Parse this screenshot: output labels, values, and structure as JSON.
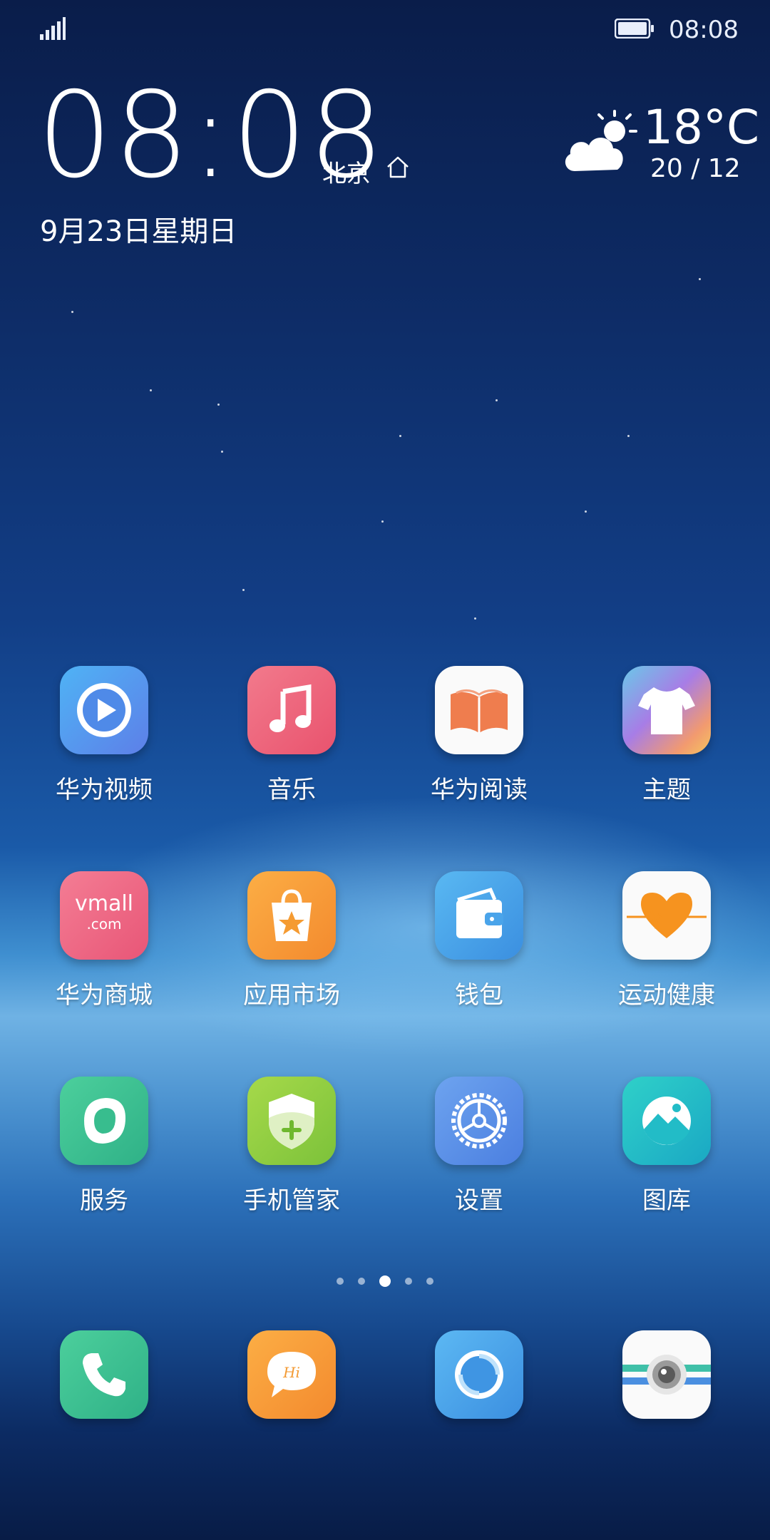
{
  "status_bar": {
    "time": "08:08",
    "signal_icon": "signal-icon",
    "battery_icon": "battery-icon"
  },
  "clock_widget": {
    "time": "08:08",
    "city": "北京",
    "date": "9月23日星期日"
  },
  "weather_widget": {
    "icon": "partly-cloudy-icon",
    "temperature": "18°C",
    "range": "20 / 12"
  },
  "apps": [
    {
      "label": "华为视频",
      "icon": "video-icon"
    },
    {
      "label": "音乐",
      "icon": "music-icon"
    },
    {
      "label": "华为阅读",
      "icon": "book-icon"
    },
    {
      "label": "主题",
      "icon": "tshirt-icon"
    },
    {
      "label": "华为商城",
      "icon": "vmall-icon",
      "tile_text": "vmall",
      "tile_subtext": ".com"
    },
    {
      "label": "应用市场",
      "icon": "shopping-bag-icon"
    },
    {
      "label": "钱包",
      "icon": "wallet-icon"
    },
    {
      "label": "运动健康",
      "icon": "heart-pulse-icon"
    },
    {
      "label": "服务",
      "icon": "service-icon"
    },
    {
      "label": "手机管家",
      "icon": "shield-icon"
    },
    {
      "label": "设置",
      "icon": "gear-icon"
    },
    {
      "label": "图库",
      "icon": "gallery-icon"
    }
  ],
  "page_indicator": {
    "pages": 5,
    "active_page": 3
  },
  "dock": [
    {
      "icon": "phone-icon"
    },
    {
      "icon": "messages-icon",
      "tile_text": "Hi"
    },
    {
      "icon": "browser-icon"
    },
    {
      "icon": "camera-icon"
    }
  ]
}
